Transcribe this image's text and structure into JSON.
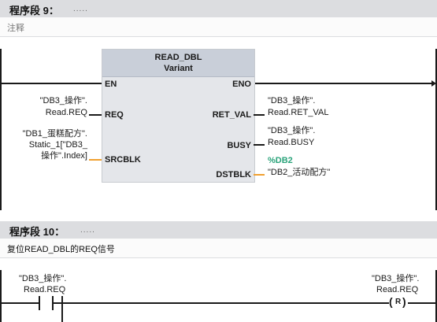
{
  "network9": {
    "title": "程序段 9：",
    "dots": ".....",
    "comment": "注释"
  },
  "function_block": {
    "name": "READ_DBL",
    "type": "Variant",
    "pins": {
      "en": "EN",
      "eno": "ENO",
      "req": "REQ",
      "srcblk": "SRCBLK",
      "ret_val": "RET_VAL",
      "busy": "BUSY",
      "dstblk": "DSTBLK"
    }
  },
  "operands": {
    "req_l1": "\"DB3_操作\".",
    "req_l2": "Read.REQ",
    "src_l1": "\"DB1_蛋糕配方\".",
    "src_l2": "Static_1[\"DB3_",
    "src_l3": "操作\".Index]",
    "retval_l1": "\"DB3_操作\".",
    "retval_l2": "Read.RET_VAL",
    "busy_l1": "\"DB3_操作\".",
    "busy_l2": "Read.BUSY",
    "dst_addr": "%DB2",
    "dst_name": "\"DB2_活动配方\""
  },
  "network10": {
    "title": "程序段 10：",
    "dots": ".....",
    "comment": "复位READ_DBL的REQ信号",
    "contact_l1": "\"DB3_操作\".",
    "contact_l2": "Read.REQ",
    "coil_l1": "\"DB3_操作\".",
    "coil_l2": "Read.REQ",
    "coil_symbol": "R"
  },
  "colors": {
    "header_bg": "#dcdde0",
    "block_header": "#c9cfd9",
    "block_body": "#e4e6ea",
    "variant_wire": "#f0a030",
    "address_green": "#2aa37a"
  }
}
